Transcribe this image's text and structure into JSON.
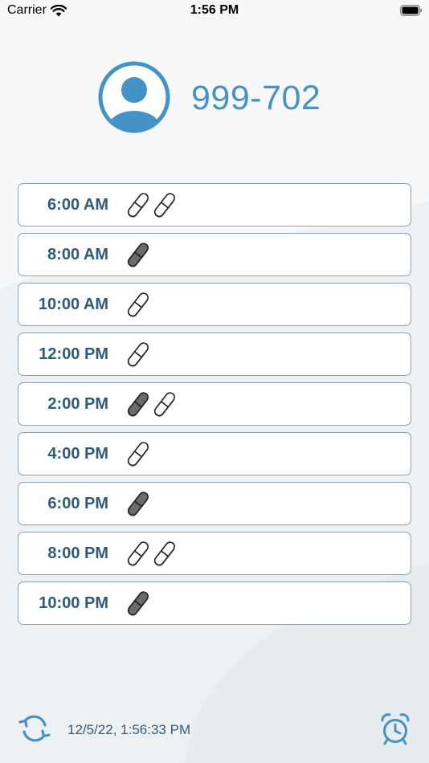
{
  "status_bar": {
    "carrier": "Carrier",
    "time": "1:56 PM"
  },
  "header": {
    "patient_id": "999-702"
  },
  "schedule": [
    {
      "time": "6:00 AM",
      "pills": [
        "white",
        "white"
      ]
    },
    {
      "time": "8:00 AM",
      "pills": [
        "gray"
      ]
    },
    {
      "time": "10:00 AM",
      "pills": [
        "white"
      ]
    },
    {
      "time": "12:00 PM",
      "pills": [
        "white"
      ]
    },
    {
      "time": "2:00 PM",
      "pills": [
        "gray",
        "white"
      ]
    },
    {
      "time": "4:00 PM",
      "pills": [
        "white"
      ]
    },
    {
      "time": "6:00 PM",
      "pills": [
        "gray"
      ]
    },
    {
      "time": "8:00 PM",
      "pills": [
        "white",
        "white"
      ]
    },
    {
      "time": "10:00 PM",
      "pills": [
        "gray"
      ]
    }
  ],
  "footer": {
    "timestamp": "12/5/22, 1:56:33 PM"
  },
  "icons": {
    "avatar": "user-avatar-icon",
    "refresh": "refresh-icon",
    "alarm": "alarm-clock-icon",
    "pill": "capsule-pill-icon",
    "wifi": "wifi-icon",
    "battery": "battery-icon"
  },
  "colors": {
    "accent": "#4492c6",
    "row_text": "#2f5b79",
    "row_border": "#8fa0b0",
    "pill_gray": "#6b6b6b",
    "pill_white": "#ffffff"
  }
}
